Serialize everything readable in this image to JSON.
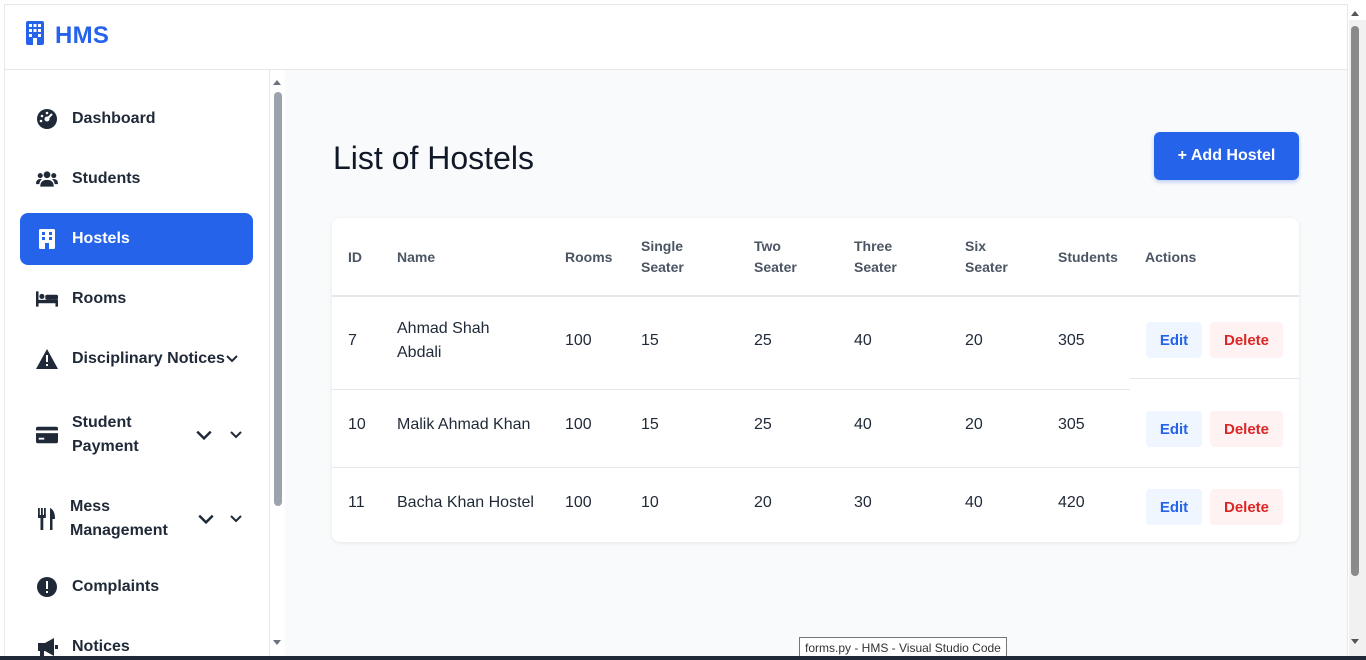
{
  "brand": {
    "name": "HMS"
  },
  "sidebar": {
    "items": [
      {
        "label": "Dashboard",
        "icon": "dashboard-gauge-icon",
        "active": false
      },
      {
        "label": "Students",
        "icon": "users-icon",
        "active": false
      },
      {
        "label": "Hostels",
        "icon": "building-icon",
        "active": true
      },
      {
        "label": "Rooms",
        "icon": "bed-icon",
        "active": false
      },
      {
        "label": "Disciplinary Notices",
        "icon": "warning-triangle-icon",
        "active": false
      },
      {
        "label_line1": "Student",
        "label_line2": "Payment",
        "icon": "credit-card-icon",
        "active": false
      },
      {
        "label_line1": "Mess",
        "label_line2": "Management",
        "icon": "utensils-icon",
        "active": false
      },
      {
        "label": "Complaints",
        "icon": "exclamation-circle-icon",
        "active": false
      },
      {
        "label": "Notices",
        "icon": "megaphone-icon",
        "active": false
      }
    ]
  },
  "main": {
    "title": "List of Hostels",
    "add_button": "+ Add Hostel",
    "table": {
      "headers": {
        "id": "ID",
        "name": "Name",
        "rooms": "Rooms",
        "single_1": "Single",
        "single_2": "Seater",
        "two_1": "Two",
        "two_2": "Seater",
        "three_1": "Three",
        "three_2": "Seater",
        "six_1": "Six",
        "six_2": "Seater",
        "students": "Students",
        "actions": "Actions"
      },
      "rows": [
        {
          "id": "7",
          "name_line1": "Ahmad Shah",
          "name_line2": "Abdali",
          "rooms": "100",
          "single": "15",
          "two": "25",
          "three": "40",
          "six": "20",
          "students": "305"
        },
        {
          "id": "10",
          "name": "Malik Ahmad Khan",
          "rooms": "100",
          "single": "15",
          "two": "25",
          "three": "40",
          "six": "20",
          "students": "305"
        },
        {
          "id": "11",
          "name": "Bacha Khan Hostel",
          "rooms": "100",
          "single": "10",
          "two": "20",
          "three": "30",
          "six": "40",
          "students": "420"
        }
      ],
      "edit_label": "Edit",
      "delete_label": "Delete"
    }
  },
  "tooltip": "forms.py - HMS - Visual Studio Code",
  "colors": {
    "accent": "#2563eb",
    "danger": "#dc2626",
    "background": "#f9fafb"
  }
}
